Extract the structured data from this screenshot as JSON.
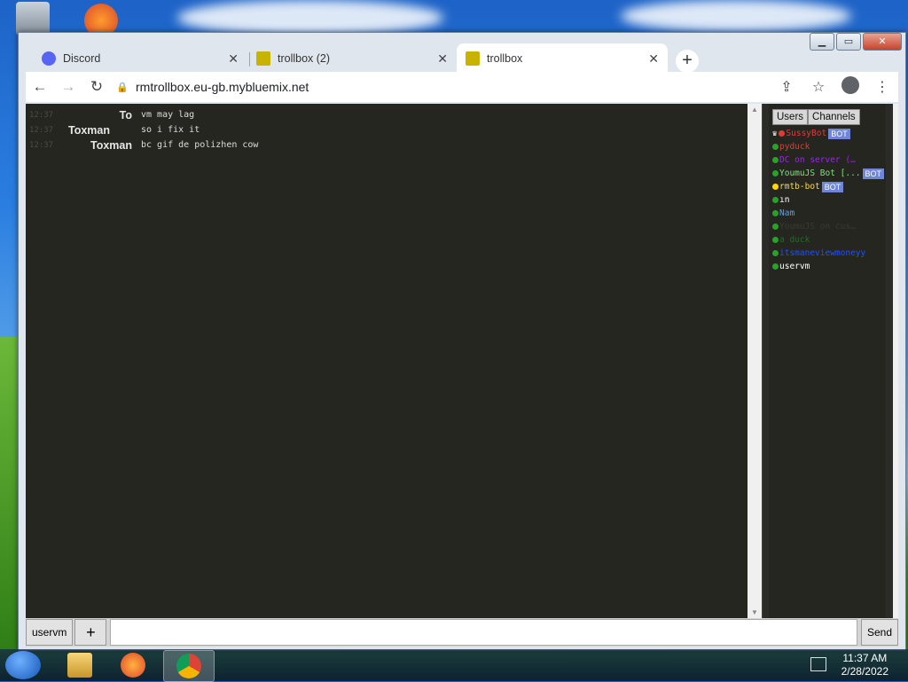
{
  "tabs": [
    {
      "label": "Discord",
      "icon": "discord-icon",
      "color": "#5865f2"
    },
    {
      "label": "trollbox (2)",
      "icon": "trollbox-icon",
      "color": "#c8b400"
    },
    {
      "label": "trollbox",
      "icon": "trollbox-icon",
      "color": "#c8b400"
    }
  ],
  "browser": {
    "url": "rmtrollbox.eu-gb.mybluemix.net",
    "new_tab": "+",
    "close_tab": "✕"
  },
  "chat": {
    "messages": [
      {
        "time": "12:37",
        "nick": "To",
        "text": "vm may lag"
      },
      {
        "time": "12:37",
        "nick": "Toxman",
        "text": "so i fix it"
      },
      {
        "time": "12:37",
        "nick": "Toxman",
        "text": "bc gif de polizhen cow"
      }
    ]
  },
  "userpane": {
    "tab_users": "Users",
    "tab_channels": "Channels",
    "users": [
      {
        "name": "SussyBot",
        "color": "#e53935",
        "dot": "#e53935",
        "bot": true,
        "crown": true
      },
      {
        "name": "pyduck",
        "color": "#e53935",
        "dot": "#27a327",
        "bot": false
      },
      {
        "name": "DC on server (…",
        "color": "#a020f0",
        "dot": "#27a327",
        "bot": false
      },
      {
        "name": "YoumuJS Bot [...",
        "color": "#7fe07f",
        "dot": "#27a327",
        "bot": true
      },
      {
        "name": "rmtb-bot",
        "color": "#ffd54f",
        "dot": "#ffd700",
        "bot": true
      },
      {
        "name": "ın",
        "color": "#ffffff",
        "dot": "#27a327",
        "bot": false
      },
      {
        "name": "Nam",
        "color": "#4aa3ff",
        "dot": "#27a327",
        "bot": false
      },
      {
        "name": "YoumuJS on cus…",
        "color": "#3a3a35",
        "dot": "#27a327",
        "bot": false
      },
      {
        "name": "a duck",
        "color": "#1f6e1f",
        "dot": "#27a327",
        "bot": false
      },
      {
        "name": "itsmaneviewmoneyy",
        "color": "#1f4fff",
        "dot": "#27a327",
        "bot": false
      },
      {
        "name": "uservm",
        "color": "#ffffff",
        "dot": "#27a327",
        "bot": false
      }
    ],
    "bot_label": "BOT"
  },
  "input": {
    "nick": "uservm",
    "plus": "+",
    "send": "Send",
    "placeholder": ""
  },
  "taskbar": {
    "time": "11:37 AM",
    "date": "2/28/2022"
  }
}
